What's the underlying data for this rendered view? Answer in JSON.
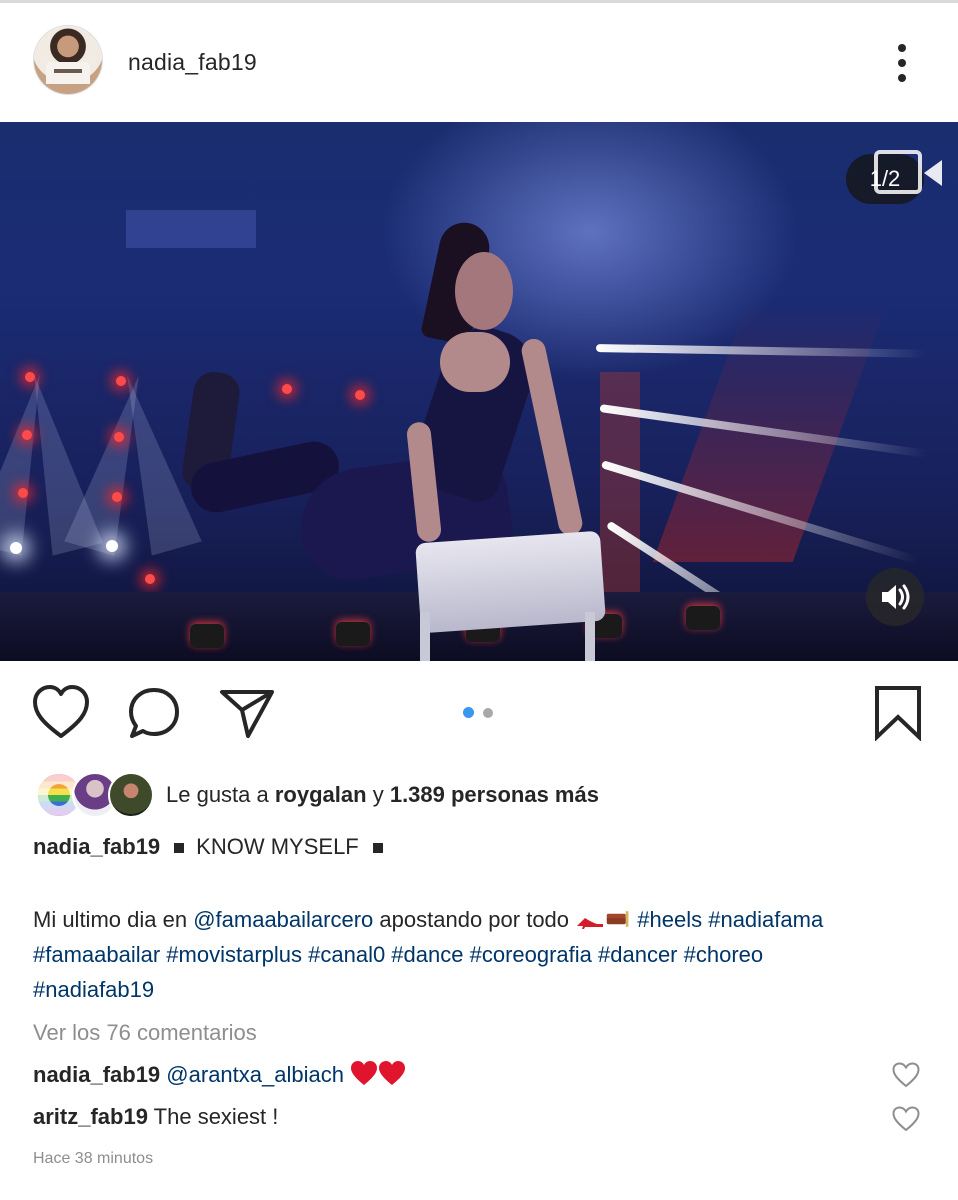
{
  "post": {
    "username": "nadia_fab19",
    "media_counter": "1/2",
    "carousel": {
      "count": 2,
      "active": 1
    }
  },
  "likes": {
    "prefix": "Le gusta a",
    "user": "roygalan",
    "middle": "y",
    "others": "1.389 personas más"
  },
  "caption": {
    "username": "nadia_fab19",
    "title": "KNOW MYSELF",
    "text_before": "Mi ultimo dia en",
    "mention": "@famaabailarcero",
    "text_after": "apostando por todo",
    "hashtags_line1": "#heels #nadiafama",
    "hashtags_line2": "#famaabailar #movistarplus #canal0 #dance #coreografia #dancer #choreo",
    "hashtags_line3": "#nadiafab19"
  },
  "comments_link": "Ver los 76 comentarios",
  "comments": [
    {
      "user": "nadia_fab19",
      "text": "@arantxa_albiach"
    },
    {
      "user": "aritz_fab19",
      "text": "The sexiest !"
    }
  ],
  "timestamp": "Hace 38 minutos",
  "colors": {
    "text": "#262626",
    "link": "#003569",
    "muted": "#8e8e8e",
    "active_dot": "#3897f0",
    "inactive_dot": "#a8a8a8",
    "heart_emoji": "#e0142c"
  },
  "icons": [
    "more-icon",
    "video-camera-icon",
    "sound-icon",
    "heart-icon",
    "comment-icon",
    "share-icon",
    "bookmark-icon"
  ]
}
